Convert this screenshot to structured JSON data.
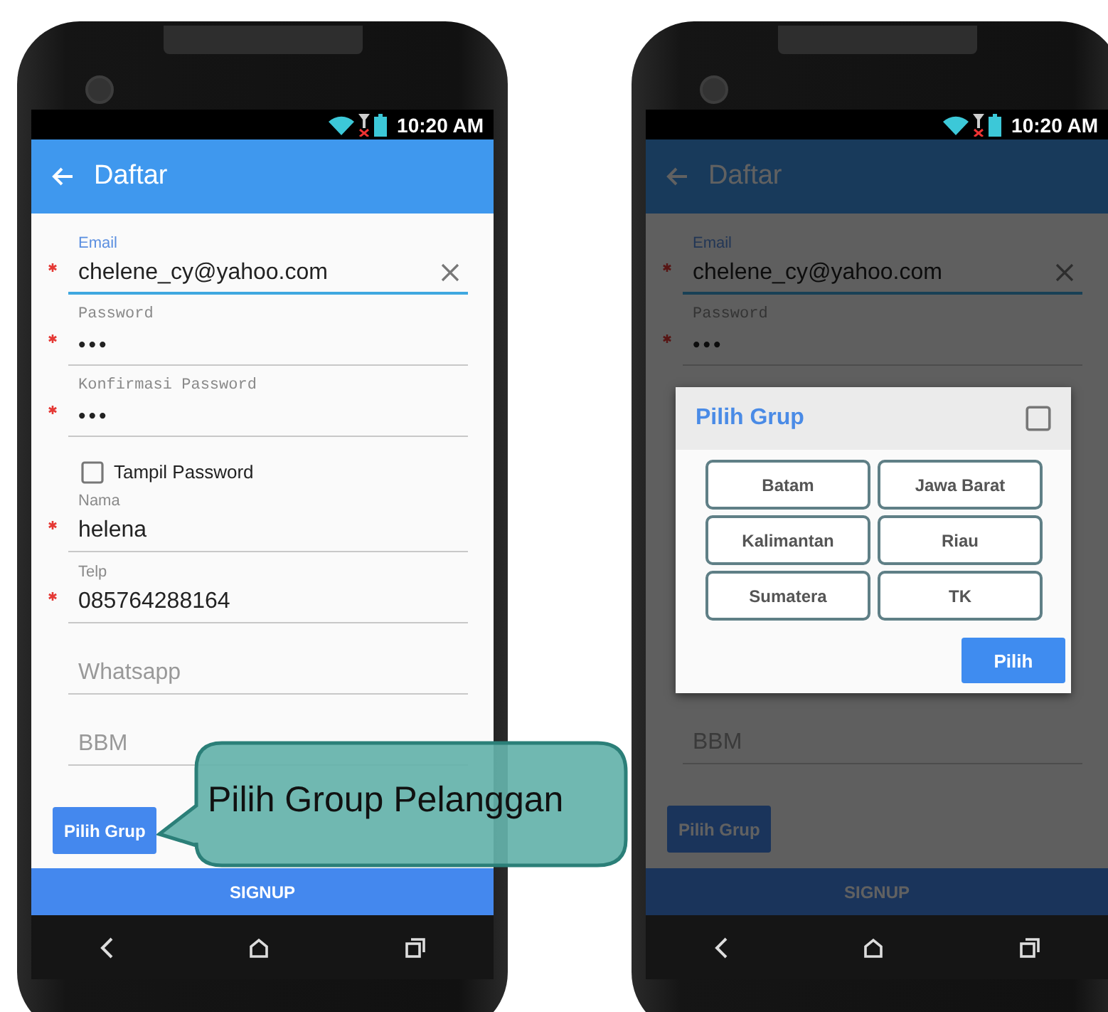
{
  "phones": [
    {
      "status_bar": {
        "time": "10:20 AM"
      },
      "app_bar": {
        "title": "Daftar"
      },
      "form": [
        {
          "kind": "text",
          "label": "Email",
          "value": "chelene_cy@yahoo.com",
          "required": true,
          "focused": true,
          "clearable": true
        },
        {
          "kind": "password",
          "label": "Password",
          "value": "•••",
          "required": true,
          "focused": false
        },
        {
          "kind": "password",
          "label": "Konfirmasi Password",
          "value": "•••",
          "required": true,
          "focused": false
        },
        {
          "kind": "checkbox",
          "label": "Tampil Password",
          "checked": false
        },
        {
          "kind": "text",
          "label": "Nama",
          "value": "helena",
          "required": true,
          "focused": false
        },
        {
          "kind": "text",
          "label": "Telp",
          "value": "085764288164",
          "required": true,
          "focused": false
        },
        {
          "kind": "text",
          "placeholder": "Whatsapp",
          "required": false,
          "focused": false
        },
        {
          "kind": "text",
          "placeholder": "BBM",
          "required": false,
          "focused": false
        }
      ],
      "group_button": "Pilih Grup",
      "signup_button": "SIGNUP"
    },
    {
      "status_bar": {
        "time": "10:20 AM"
      },
      "app_bar": {
        "title": "Daftar"
      },
      "form": [
        {
          "kind": "text",
          "label": "Email",
          "value": "chelene_cy@yahoo.com",
          "required": true,
          "focused": true,
          "clearable": true
        },
        {
          "kind": "password",
          "label": "Password",
          "value": "•••",
          "required": true,
          "focused": false
        },
        {
          "kind": "dialog",
          "title": "Pilih Grup",
          "checked": false,
          "groups": [
            "Batam",
            "Jawa Barat",
            "Kalimantan",
            "Riau",
            "Sumatera",
            "TK"
          ],
          "confirm_button": "Pilih"
        },
        {
          "kind": "text",
          "placeholder": "BBM",
          "required": false,
          "focused": false
        }
      ],
      "group_button": "Pilih Grup",
      "signup_button": "SIGNUP"
    }
  ],
  "callout": {
    "text": "Pilih Group Pelanggan"
  }
}
